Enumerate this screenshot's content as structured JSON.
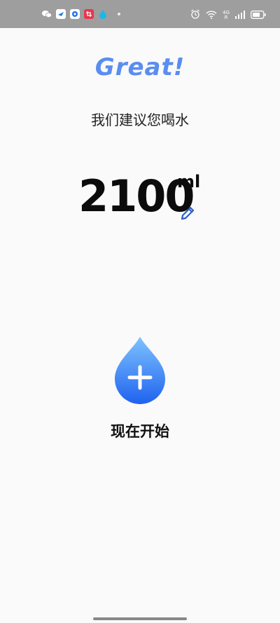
{
  "status_bar": {
    "network_label_top": "4G",
    "network_label_bottom": "R",
    "notification_icons": [
      "wechat-icon",
      "bird-app-icon",
      "blue-app-icon",
      "crop-app-icon",
      "droplet-app-icon"
    ],
    "right_icons": [
      "alarm-icon",
      "wifi-icon",
      "cellular-signal-icon",
      "battery-icon"
    ]
  },
  "header": {
    "title": "Great!"
  },
  "recommendation": {
    "text": "我们建议您喝水",
    "amount": "2100",
    "unit": "ml"
  },
  "action": {
    "label": "现在开始"
  },
  "colors": {
    "accent": "#5b8df0",
    "drop_top": "#7ec3ff",
    "drop_bottom": "#1f63ef",
    "edit_icon": "#2b5fc9"
  }
}
